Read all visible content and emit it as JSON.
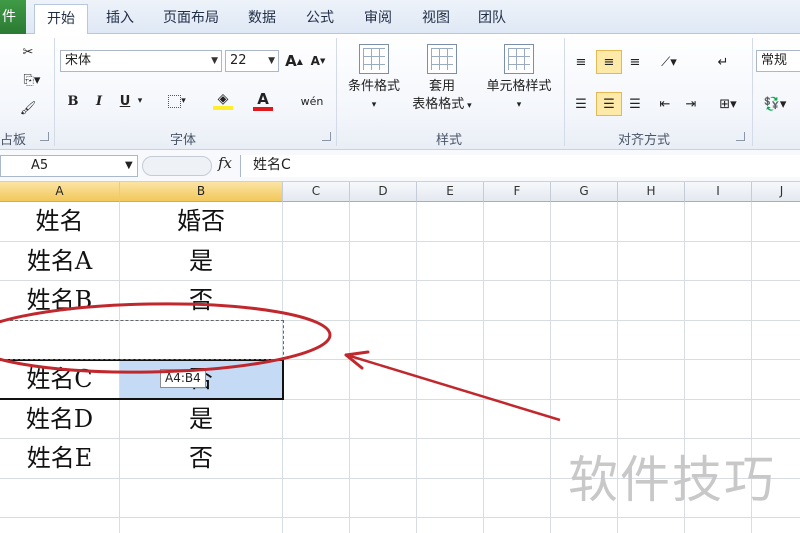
{
  "tabs": {
    "file": "件",
    "home": "开始",
    "insert": "插入",
    "layout": "页面布局",
    "data": "数据",
    "formula": "公式",
    "review": "审阅",
    "view": "视图",
    "team": "团队"
  },
  "ribbon": {
    "clipboard_label": "占板",
    "font": {
      "family": "宋体",
      "size": "22",
      "group_label": "字体",
      "bold": "B",
      "italic": "I",
      "underline": "U",
      "font_color": "A",
      "phonetic": "wén"
    },
    "styles": {
      "conditional_format": "条件格式",
      "table_format_line1": "套用",
      "table_format_line2": "表格格式",
      "cell_styles": "单元格样式",
      "group_label": "样式"
    },
    "alignment": {
      "group_label": "对齐方式"
    },
    "number": {
      "format": "常规"
    }
  },
  "formula_bar": {
    "name_box": "A5",
    "fx": "fx",
    "content": "姓名C"
  },
  "columns": [
    "A",
    "B",
    "C",
    "D",
    "E",
    "F",
    "G",
    "H",
    "I",
    "J"
  ],
  "rows": [
    {
      "a": "姓名",
      "b": "婚否"
    },
    {
      "a": "姓名A",
      "b": "是"
    },
    {
      "a": "姓名B",
      "b": "否"
    },
    {
      "a": "",
      "b": ""
    },
    {
      "a": "姓名C",
      "b": "否"
    },
    {
      "a": "姓名D",
      "b": "是"
    },
    {
      "a": "姓名E",
      "b": "否"
    }
  ],
  "tooltip": "A4:B4",
  "watermark": "软件技巧",
  "colors": {
    "accent": "#c0282d",
    "selection": "#c5dbf5",
    "file_tab": "#2b7a33"
  }
}
